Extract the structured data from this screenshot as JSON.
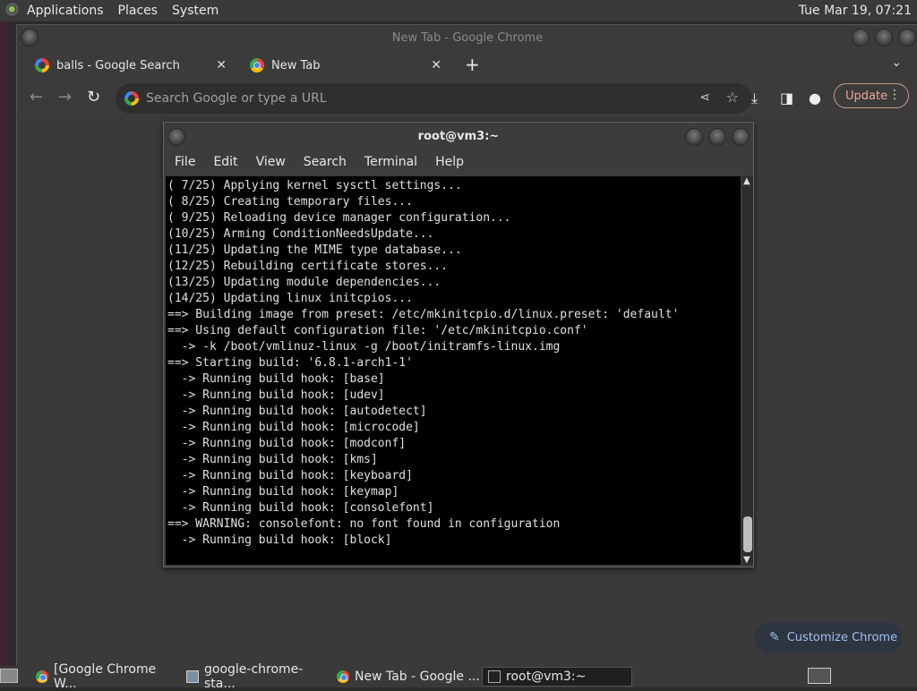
{
  "top_panel": {
    "menu": [
      "Applications",
      "Places",
      "System"
    ],
    "clock": "Tue Mar 19, 07:21"
  },
  "chrome": {
    "window_title": "New Tab - Google Chrome",
    "tabs": [
      {
        "label": "balls - Google Search",
        "icon": "google-icon"
      },
      {
        "label": "New Tab",
        "icon": "chrome-icon"
      }
    ],
    "new_tab_symbol": "+",
    "tab_search_symbol": "⌄",
    "omnibox_placeholder": "Search Google or type a URL",
    "update_label": "Update",
    "customize_label": "Customize Chrome",
    "colors": {
      "background": "#3a3a3a",
      "update_accent": "#f0a898",
      "customize_accent": "#9ec1f0"
    }
  },
  "terminal": {
    "title": "root@vm3:~",
    "menu": [
      "File",
      "Edit",
      "View",
      "Search",
      "Terminal",
      "Help"
    ],
    "lines": [
      "( 7/25) Applying kernel sysctl settings...",
      "( 8/25) Creating temporary files...",
      "( 9/25) Reloading device manager configuration...",
      "(10/25) Arming ConditionNeedsUpdate...",
      "(11/25) Updating the MIME type database...",
      "(12/25) Rebuilding certificate stores...",
      "(13/25) Updating module dependencies...",
      "(14/25) Updating linux initcpios...",
      "==> Building image from preset: /etc/mkinitcpio.d/linux.preset: 'default'",
      "==> Using default configuration file: '/etc/mkinitcpio.conf'",
      "  -> -k /boot/vmlinuz-linux -g /boot/initramfs-linux.img",
      "==> Starting build: '6.8.1-arch1-1'",
      "  -> Running build hook: [base]",
      "  -> Running build hook: [udev]",
      "  -> Running build hook: [autodetect]",
      "  -> Running build hook: [microcode]",
      "  -> Running build hook: [modconf]",
      "  -> Running build hook: [kms]",
      "  -> Running build hook: [keyboard]",
      "  -> Running build hook: [keymap]",
      "  -> Running build hook: [consolefont]",
      "==> WARNING: consolefont: no font found in configuration",
      "  -> Running build hook: [block]"
    ]
  },
  "taskbar": {
    "items": [
      {
        "label": "[Google Chrome W...",
        "icon": "chrome-icon"
      },
      {
        "label": "google-chrome-sta...",
        "icon": "package-icon"
      },
      {
        "label": "New Tab - Google ...",
        "icon": "chrome-icon"
      },
      {
        "label": "root@vm3:~",
        "icon": "terminal-icon"
      }
    ]
  }
}
